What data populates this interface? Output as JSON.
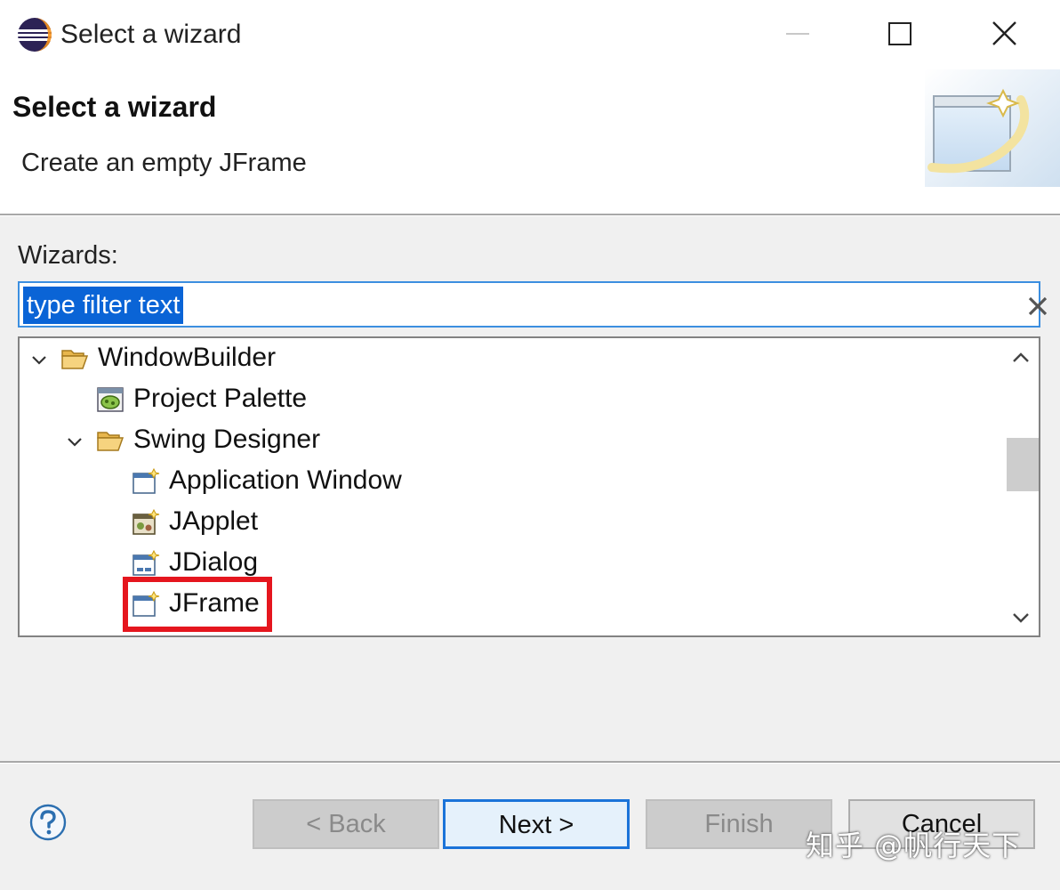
{
  "window": {
    "title": "Select a wizard"
  },
  "banner": {
    "title": "Select a wizard",
    "description": "Create an empty JFrame"
  },
  "filter": {
    "label": "Wizards:",
    "value": "type filter text"
  },
  "tree": {
    "items": [
      {
        "label": "WindowBuilder",
        "icon": "folder-open-icon",
        "expanded": true,
        "depth": 0
      },
      {
        "label": "Project Palette",
        "icon": "palette-icon",
        "depth": 1
      },
      {
        "label": "Swing Designer",
        "icon": "folder-open-icon",
        "expanded": true,
        "depth": 1
      },
      {
        "label": "Application Window",
        "icon": "window-wizard-icon",
        "depth": 2
      },
      {
        "label": "JApplet",
        "icon": "applet-icon",
        "depth": 2
      },
      {
        "label": "JDialog",
        "icon": "dialog-wizard-icon",
        "depth": 2
      },
      {
        "label": "JFrame",
        "icon": "window-wizard-icon",
        "depth": 2,
        "selected": true
      }
    ]
  },
  "buttons": {
    "back": "< Back",
    "next": "Next >",
    "finish": "Finish",
    "cancel": "Cancel"
  },
  "watermark": "知乎 @帆行天下",
  "colors": {
    "selection": "#0a64d6",
    "focus_border": "#3c8fe0",
    "highlight": "#e5161e",
    "default_button_border": "#1a73d9"
  }
}
